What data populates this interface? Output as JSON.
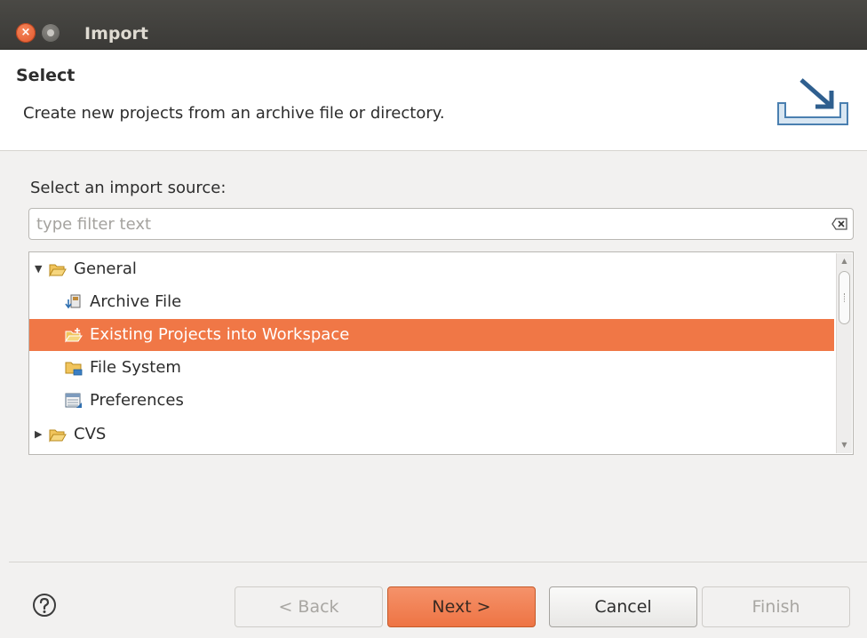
{
  "window": {
    "title": "Import",
    "close_glyph": "×"
  },
  "header": {
    "title": "Select",
    "description": "Create new projects from an archive file or directory.",
    "icon": "import-wizard-icon"
  },
  "source": {
    "label": "Select an import source:",
    "filter_placeholder": "type filter text",
    "filter_value": ""
  },
  "tree": {
    "items": [
      {
        "label": "General",
        "expanded": true,
        "icon": "folder-open-icon"
      },
      {
        "label": "Archive File",
        "icon": "archive-file-icon"
      },
      {
        "label": "Existing Projects into Workspace",
        "icon": "existing-projects-icon",
        "selected": true
      },
      {
        "label": "File System",
        "icon": "folder-icon"
      },
      {
        "label": "Preferences",
        "icon": "preferences-icon"
      },
      {
        "label": "CVS",
        "expanded": false,
        "icon": "folder-open-icon"
      }
    ]
  },
  "buttons": {
    "back": "< Back",
    "next": "Next >",
    "cancel": "Cancel",
    "finish": "Finish"
  },
  "colors": {
    "selection": "#f07746",
    "titlebar": "#3c3b37",
    "close": "#e9612f"
  }
}
